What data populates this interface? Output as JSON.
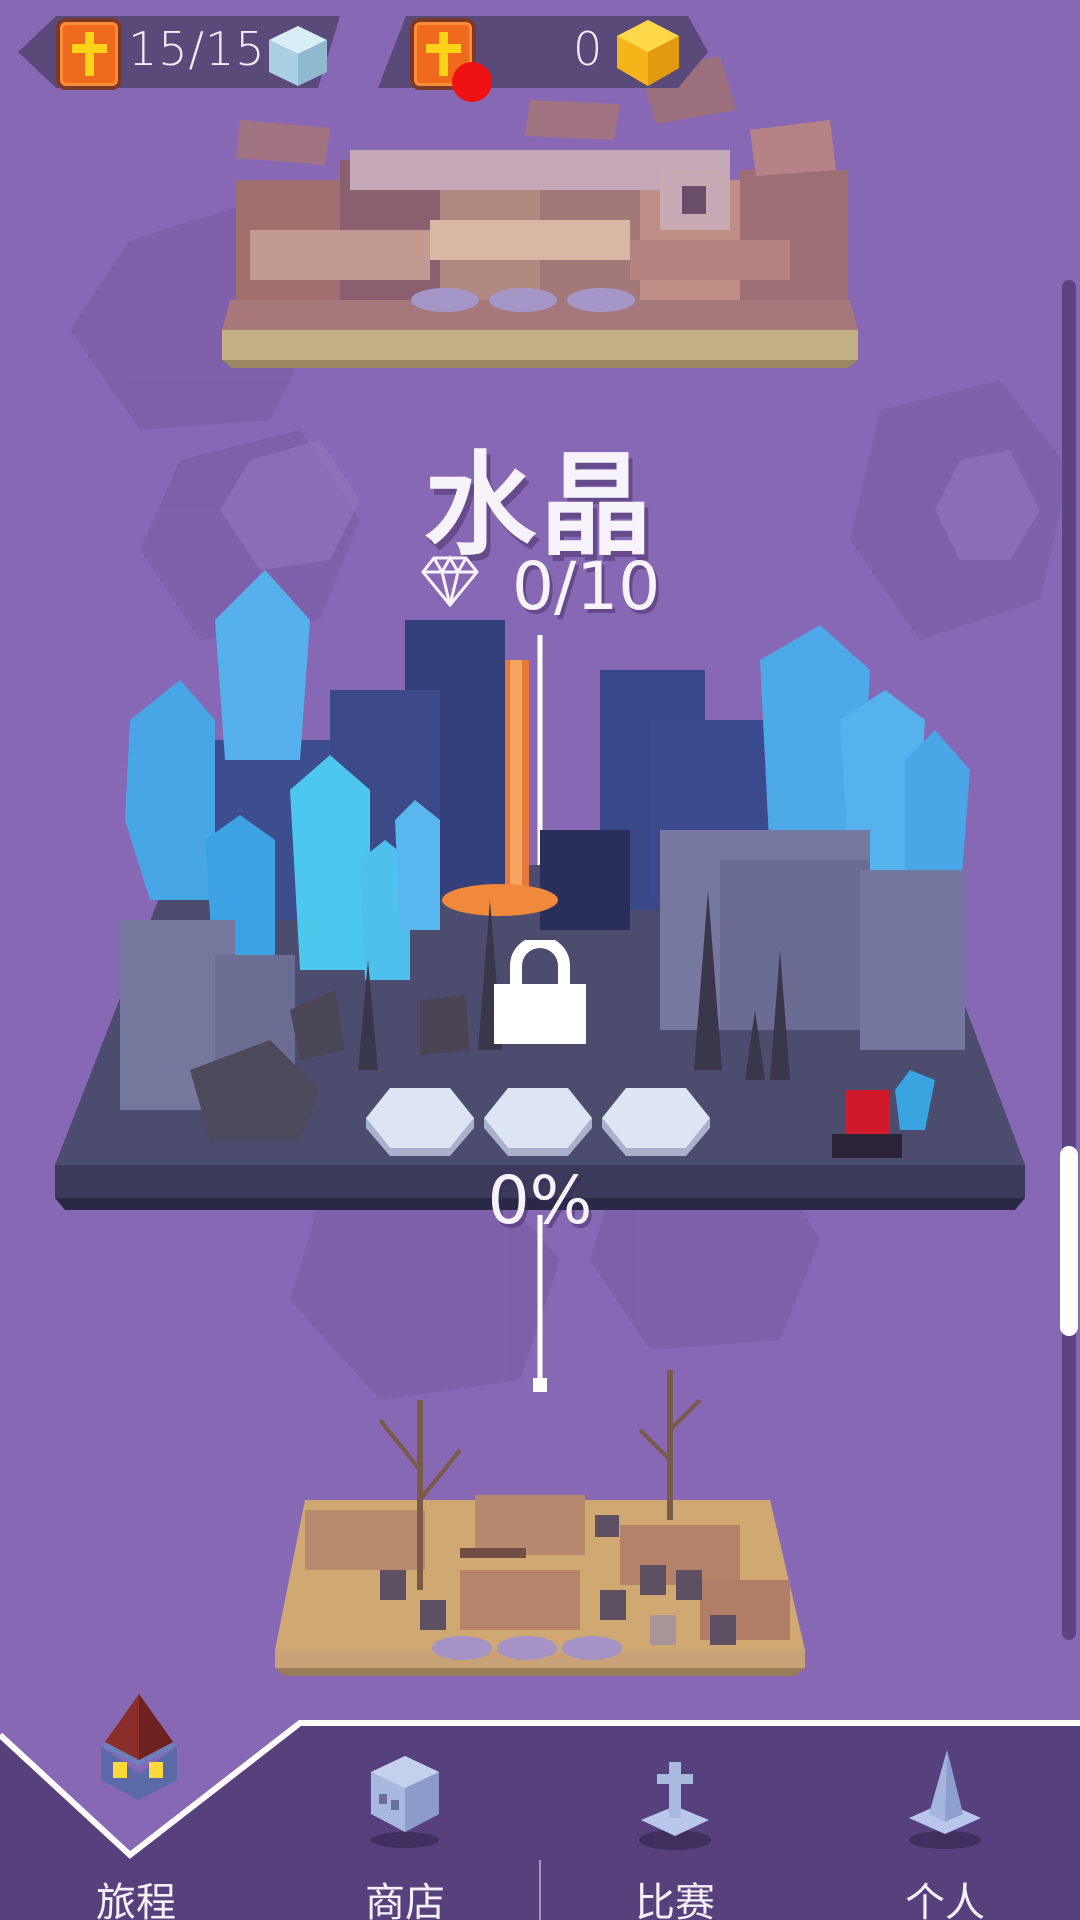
{
  "hud": {
    "lives": "15/15",
    "coins": "0",
    "icons": [
      "cross-badge-icon",
      "ice-cube-icon",
      "gold-gem-icon",
      "notification-dot"
    ]
  },
  "level": {
    "title": "水晶",
    "gems": "0/10",
    "progress": "0%",
    "locked": true
  },
  "nav": {
    "items": [
      {
        "label": "旅程",
        "icon": "house-icon",
        "active": true
      },
      {
        "label": "商店",
        "icon": "skull-icon",
        "active": false
      },
      {
        "label": "比赛",
        "icon": "gravestone-icon",
        "active": false
      },
      {
        "label": "个人",
        "icon": "witch-hat-icon",
        "active": false
      }
    ]
  },
  "colors": {
    "background": "#8768b4",
    "nav_bar": "#56417c",
    "text": "#f7f3fb",
    "badge": "#f06a1e",
    "alert": "#f01212"
  }
}
